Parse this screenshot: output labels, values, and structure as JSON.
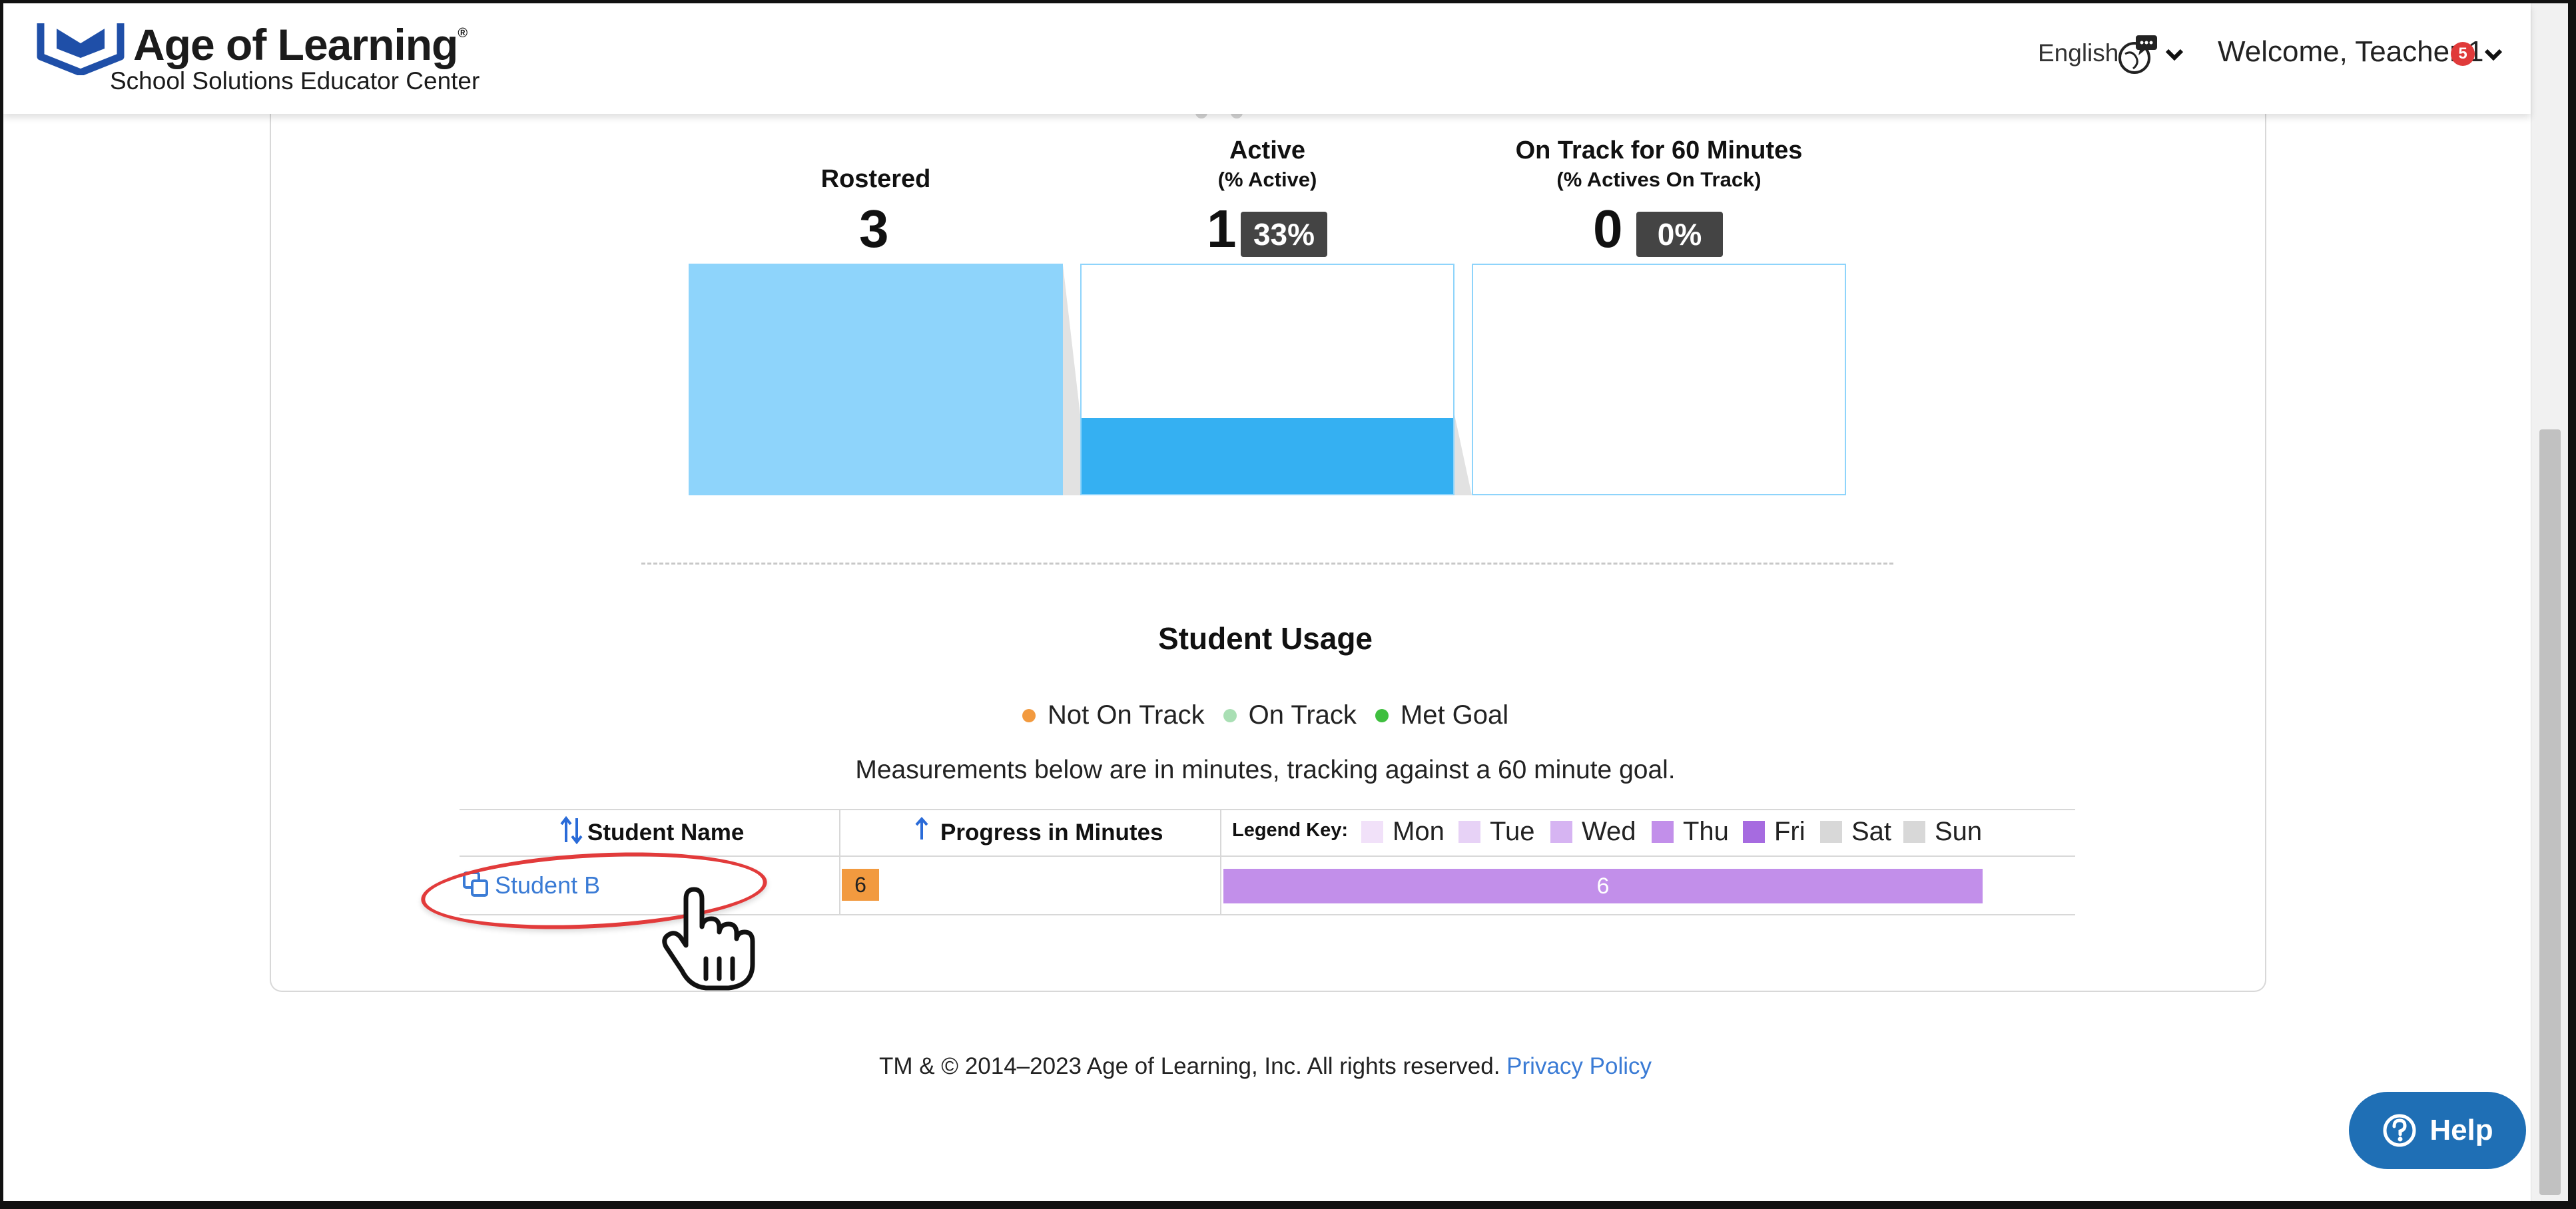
{
  "header": {
    "brand_title": "Age of Learning",
    "brand_reg": "®",
    "brand_subtitle": "School Solutions Educator Center",
    "language": "English",
    "welcome": "Welcome, Teacher 1",
    "notification_count": "5"
  },
  "metrics": {
    "rostered": {
      "title": "Rostered",
      "value": "3"
    },
    "active": {
      "title": "Active",
      "subtitle": "(% Active)",
      "value": "1",
      "percent": "33%",
      "fill_fraction": 0.33
    },
    "on_track": {
      "title": "On Track for 60 Minutes",
      "subtitle": "(% Actives On Track)",
      "value": "0",
      "percent": "0%",
      "fill_fraction": 0
    }
  },
  "usage": {
    "title": "Student Usage",
    "legend": [
      {
        "label": "Not On Track",
        "color": "#f29a3f"
      },
      {
        "label": "On Track",
        "color": "#a9dfb4"
      },
      {
        "label": "Met Goal",
        "color": "#3fbf3f"
      }
    ],
    "measurement_note": "Measurements below are in minutes, tracking against a 60 minute goal.",
    "table": {
      "col_student": "Student Name",
      "col_progress": "Progress in Minutes",
      "legend_key_label": "Legend Key:",
      "days": [
        {
          "label": "Mon",
          "color": "#f1e1f9"
        },
        {
          "label": "Tue",
          "color": "#e7d2f6"
        },
        {
          "label": "Wed",
          "color": "#d6b4f2"
        },
        {
          "label": "Thu",
          "color": "#c28fea"
        },
        {
          "label": "Fri",
          "color": "#a66be0"
        },
        {
          "label": "Sat",
          "color": "#d8d8d8"
        },
        {
          "label": "Sun",
          "color": "#d8d8d8"
        }
      ],
      "rows": [
        {
          "student": "Student B",
          "progress": "6",
          "usage_value": "6"
        }
      ]
    }
  },
  "footer": {
    "copyright": "TM & © 2014–2023 Age of Learning, Inc. All rights reserved.",
    "privacy": "Privacy Policy"
  },
  "help": {
    "label": "Help"
  },
  "colors": {
    "brand_blue": "#1f6fb5",
    "rostered_fill": "#8ed4fb",
    "active_fill": "#35b0f2",
    "link": "#3a7bd5",
    "annotation": "#e23b3b"
  }
}
